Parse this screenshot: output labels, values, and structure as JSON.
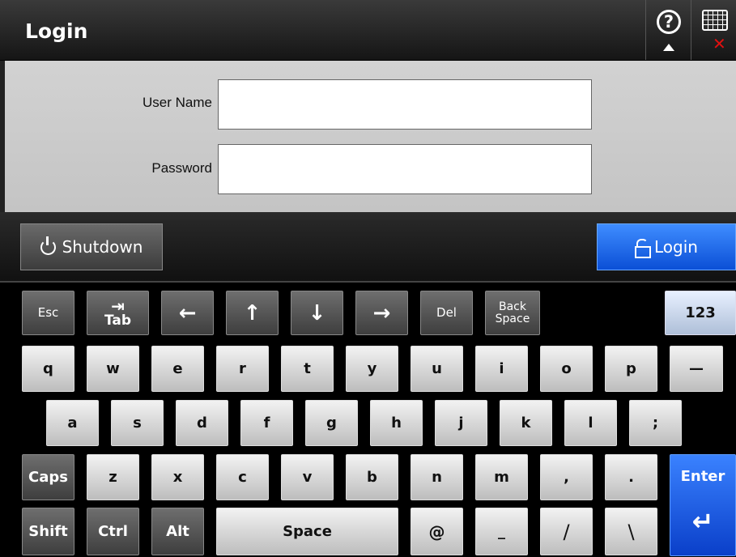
{
  "header": {
    "title": "Login"
  },
  "icons": {
    "help": "help-circle-icon",
    "keyboard": "keyboard-close-icon"
  },
  "help": {
    "symbol": "?"
  },
  "form": {
    "username_label": "User Name",
    "username_value": "",
    "password_label": "Password",
    "password_value": ""
  },
  "actions": {
    "shutdown_label": "Shutdown",
    "login_label": "Login"
  },
  "keyboard": {
    "esc": "Esc",
    "tab": "Tab",
    "left": "←",
    "up": "↑",
    "down": "↓",
    "right": "→",
    "del": "Del",
    "backspace_1": "Back",
    "backspace_2": "Space",
    "num": "123",
    "row1": [
      "q",
      "w",
      "e",
      "r",
      "t",
      "y",
      "u",
      "i",
      "o",
      "p",
      "—"
    ],
    "row2": [
      "a",
      "s",
      "d",
      "f",
      "g",
      "h",
      "j",
      "k",
      "l",
      ";"
    ],
    "row3": [
      "z",
      "x",
      "c",
      "v",
      "b",
      "n",
      "m",
      ",",
      "."
    ],
    "caps": "Caps",
    "enter": "Enter",
    "shift": "Shift",
    "ctrl": "Ctrl",
    "alt": "Alt",
    "space": "Space",
    "at": "@",
    "underscore": "_",
    "slash": "/",
    "backslash": "\\"
  },
  "colors": {
    "accent_blue": "#1a5fe8",
    "error_red": "#e01010",
    "form_bg": "#c9c9c9"
  }
}
